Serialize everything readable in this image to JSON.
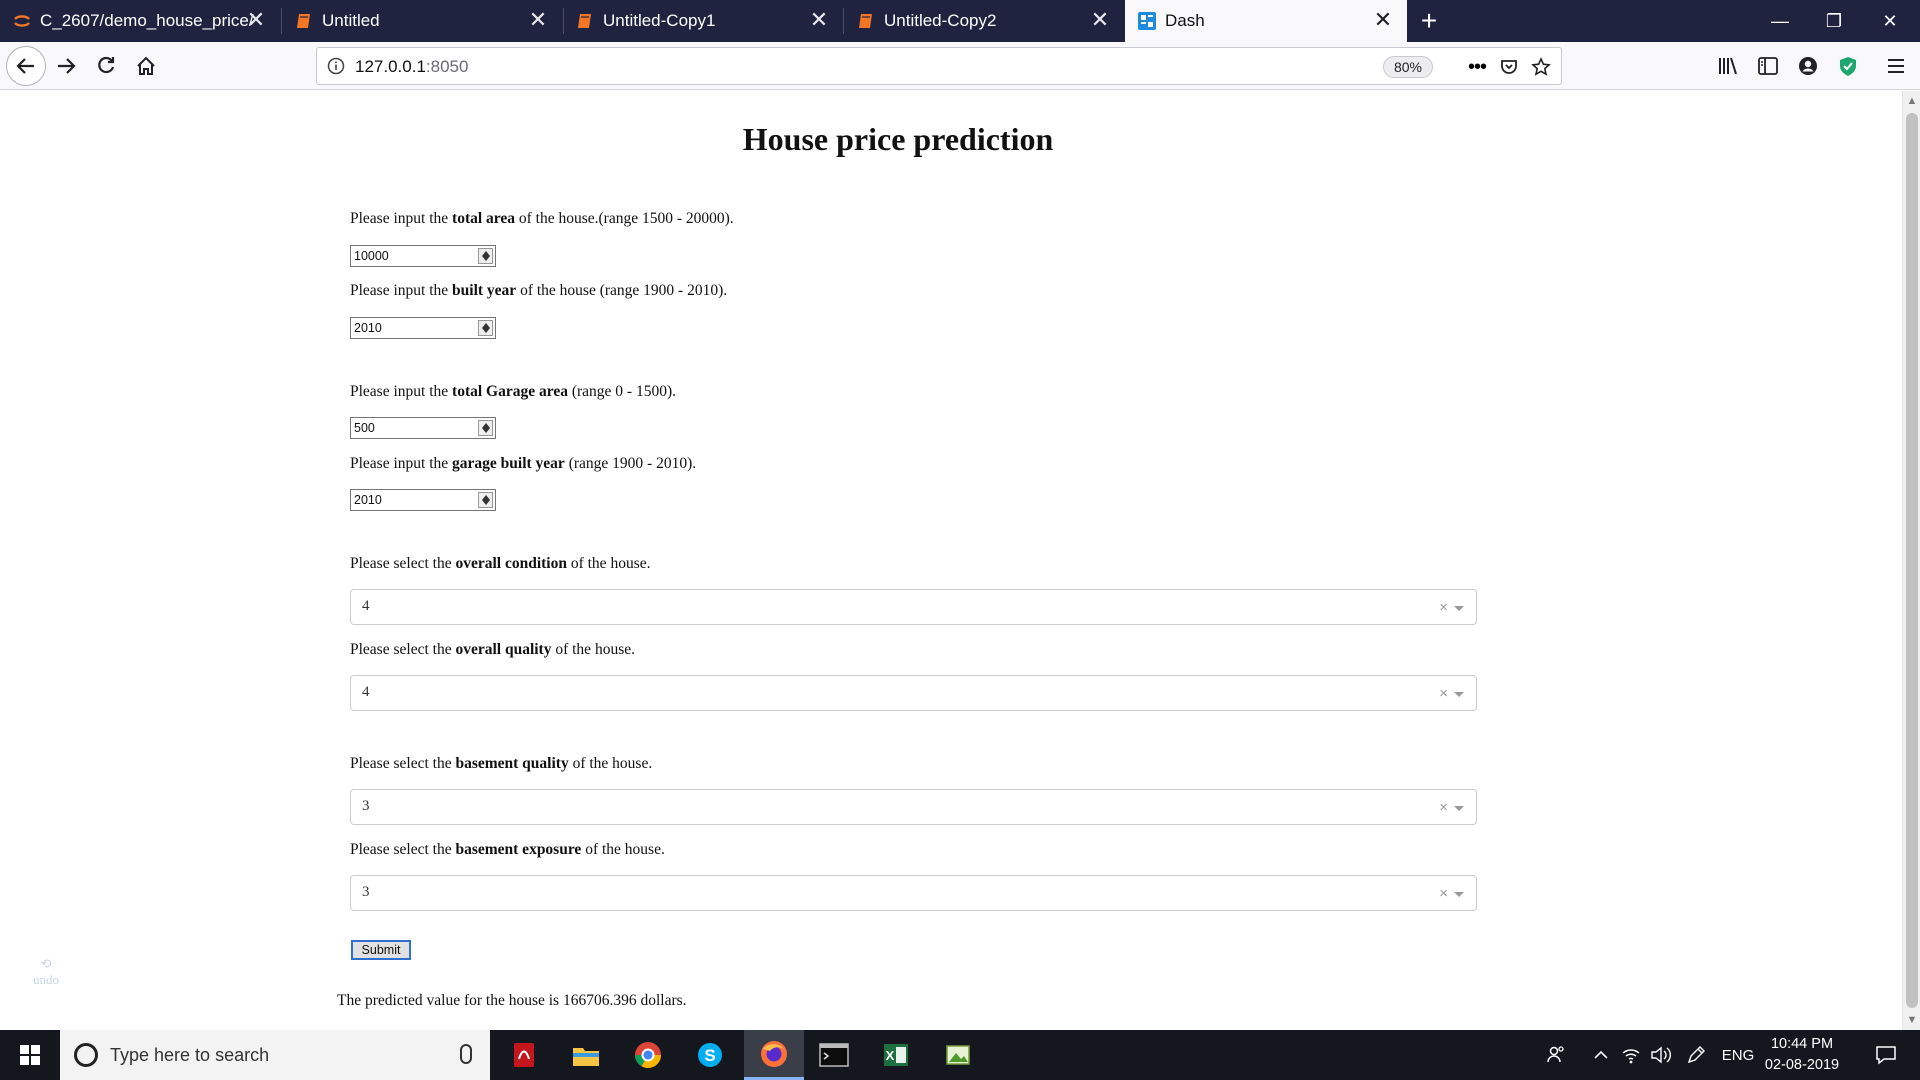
{
  "browser": {
    "tabs": [
      {
        "label": "C_2607/demo_house_price/",
        "icon": "jupyter-icon",
        "active": false
      },
      {
        "label": "Untitled",
        "icon": "notebook-icon",
        "active": false
      },
      {
        "label": "Untitled-Copy1",
        "icon": "notebook-icon",
        "active": false
      },
      {
        "label": "Untitled-Copy2",
        "icon": "notebook-icon",
        "active": false
      },
      {
        "label": "Dash",
        "icon": "dash-icon",
        "active": true
      }
    ],
    "url_host": "127.0.0.1",
    "url_port": ":8050",
    "zoom": "80%"
  },
  "page": {
    "title": "House price prediction",
    "fields": [
      {
        "pre": "Please input the ",
        "bold": "total area",
        "post": " of the house.(range 1500 - 20000).",
        "value": "10000"
      },
      {
        "pre": "Please input the ",
        "bold": "built year",
        "post": " of the house (range 1900 - 2010).",
        "value": "2010"
      },
      {
        "pre": "Please input the ",
        "bold": "total Garage area",
        "post": " (range 0 - 1500).",
        "value": "500"
      },
      {
        "pre": "Please input the ",
        "bold": "garage built year",
        "post": " (range 1900 - 2010).",
        "value": "2010"
      }
    ],
    "selects": [
      {
        "pre": "Please select the ",
        "bold": "overall condition",
        "post": " of the house.",
        "value": "4"
      },
      {
        "pre": "Please select the ",
        "bold": "overall quality",
        "post": " of the house.",
        "value": "4"
      },
      {
        "pre": "Please select the ",
        "bold": "basement quality",
        "post": " of the house.",
        "value": "3"
      },
      {
        "pre": "Please select the ",
        "bold": "basement exposure",
        "post": " of the house.",
        "value": "3"
      }
    ],
    "clear_glyph": "×",
    "submit_label": "Submit",
    "result_text": "The predicted value for the house is 166706.396 dollars.",
    "undo_label": "undo"
  },
  "taskbar": {
    "search_placeholder": "Type here to search",
    "language": "ENG",
    "time": "10:44 PM",
    "date": "02-08-2019"
  },
  "colors": {
    "tabbar_bg": "#202340",
    "taskbar_bg": "#14171e",
    "submit_border": "#2f6fcf"
  }
}
